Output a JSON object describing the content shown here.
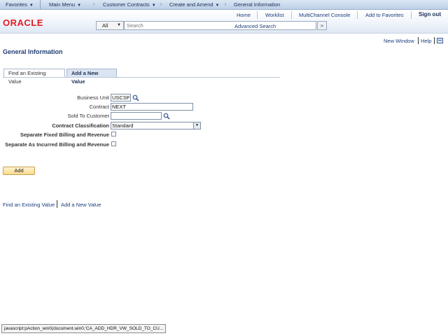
{
  "nav": {
    "favorites": "Favorites",
    "main_menu": "Main Menu",
    "crumb_1": "Customer Contracts",
    "crumb_2": "Create and Amend",
    "crumb_3": "General Information"
  },
  "header": {
    "logo": "ORACLE",
    "links": [
      "Home",
      "Worklist",
      "MultiChannel Console",
      "Add to Favorites"
    ],
    "sign_out": "Sign out",
    "search_scope": "All",
    "search_placeholder": "Search",
    "search_go": "»",
    "advanced_search": "Advanced Search"
  },
  "utility": {
    "new_window": "New Window",
    "help": "Help"
  },
  "page_title": "General Information",
  "tabs": {
    "find_existing": "Find an Existing Value",
    "add_new": "Add a New Value"
  },
  "form": {
    "business_unit": {
      "label": "Business Unit",
      "value": "USCSP"
    },
    "contract": {
      "label": "Contract",
      "value": "NEXT"
    },
    "sold_to": {
      "label": "Sold To Customer",
      "value": ""
    },
    "classification": {
      "label": "Contract Classification",
      "value": "Standard"
    },
    "sep_fixed": {
      "label": "Separate Fixed Billing and Revenue",
      "checked": false
    },
    "sep_incurred": {
      "label": "Separate As Incurred Billing and Revenue",
      "checked": false
    }
  },
  "add_button": "Add",
  "bottom_links": {
    "find_existing": "Find an Existing Value",
    "add_new": "Add a New Value"
  },
  "status_bar": "javascript:pAction_win0(document.win0,'CA_ADD_HDR_VW_SOLD_TO_CU...",
  "colors": {
    "oracle_red": "#e31b23",
    "link_blue": "#1d3d7a",
    "title_blue": "#1f3d73",
    "nav_bar": "#bccfe6"
  }
}
